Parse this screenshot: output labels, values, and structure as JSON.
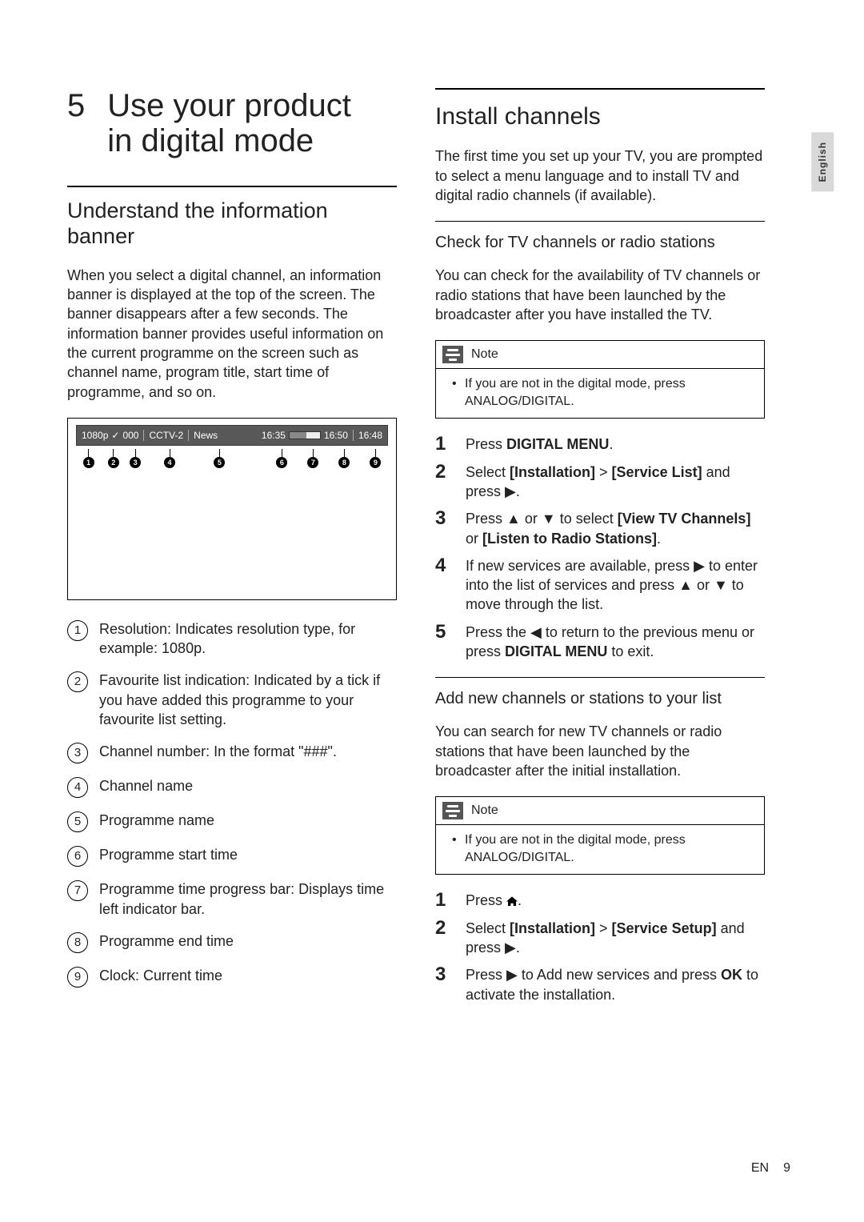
{
  "language_tab": "English",
  "chapter": {
    "number": "5",
    "title_line1": "Use your product",
    "title_line2": "in digital mode"
  },
  "left": {
    "h2": "Understand the information banner",
    "intro": "When you select a digital channel, an information banner is displayed at the top of the screen. The banner disappears after a few seconds. The information banner provides useful information on the current programme on the screen such as channel name, program title, start time of programme, and so on.",
    "banner": {
      "resolution": "1080p",
      "tick_glyph": "✓",
      "chno": "000",
      "chname": "CCTV-2",
      "progname": "News",
      "start": "16:35",
      "end": "16:50",
      "clock": "16:48"
    },
    "legend": [
      {
        "n": "1",
        "t": "Resolution: Indicates resolution type, for example: 1080p."
      },
      {
        "n": "2",
        "t": "Favourite list indication: Indicated by a tick if you have added this programme to your favourite list setting."
      },
      {
        "n": "3",
        "t": "Channel number: In the format \"###\"."
      },
      {
        "n": "4",
        "t": "Channel name"
      },
      {
        "n": "5",
        "t": "Programme name"
      },
      {
        "n": "6",
        "t": "Programme start time"
      },
      {
        "n": "7",
        "t": "Programme time progress bar: Displays time left indicator bar."
      },
      {
        "n": "8",
        "t": "Programme end time"
      },
      {
        "n": "9",
        "t": "Clock: Current time"
      }
    ]
  },
  "right": {
    "h2": "Install channels",
    "intro": "The first time you set up your TV, you are prompted to select a menu language and to install TV and digital radio channels (if available).",
    "sec1": {
      "h3": "Check for TV channels or radio stations",
      "body": "You can check for the availability of TV channels or radio stations that have been launched by the broadcaster after you have installed the TV.",
      "note_title": "Note",
      "note_body_pre": "If you are not in the digital mode, press ",
      "note_body_bold": "ANALOG/DIGITAL",
      "note_body_post": ".",
      "steps": [
        {
          "n": "1",
          "html": "Press <b>DIGITAL MENU</b>."
        },
        {
          "n": "2",
          "html": "Select <b>[Installation]</b> &gt; <b>[Service List]</b> and press <span class='arrow'>▶</span>."
        },
        {
          "n": "3",
          "html": "Press <span class='arrow'>▲</span> or <span class='arrow'>▼</span> to select <b>[View TV Channels]</b> or <b>[Listen to Radio Stations]</b>."
        },
        {
          "n": "4",
          "html": "If new services are available, press <span class='arrow'>▶</span> to enter into the list of services and press <span class='arrow'>▲</span> or <span class='arrow'>▼</span> to move through the list."
        },
        {
          "n": "5",
          "html": "Press the <span class='arrow'>◀</span> to return to the previous menu or press <b>DIGITAL MENU</b> to exit."
        }
      ]
    },
    "sec2": {
      "h3": "Add new channels or stations to your list",
      "body": "You can search for new TV channels or radio stations that have been launched by the broadcaster after the initial installation.",
      "note_title": "Note",
      "note_body_pre": "If you are not in the digital mode, press ",
      "note_body_bold": "ANALOG/DIGITAL",
      "note_body_post": ".",
      "steps": [
        {
          "n": "1",
          "html": "Press <span class='home-icon' data-name='home-icon' data-interactable='false'></span>."
        },
        {
          "n": "2",
          "html": "Select <b>[Installation]</b> &gt; <b>[Service Setup]</b> and press <span class='arrow'>▶</span>."
        },
        {
          "n": "3",
          "html": "Press <span class='arrow'>▶</span> to Add new services and press <b>OK</b> to activate the installation."
        }
      ]
    }
  },
  "footer": {
    "lang": "EN",
    "page": "9"
  }
}
